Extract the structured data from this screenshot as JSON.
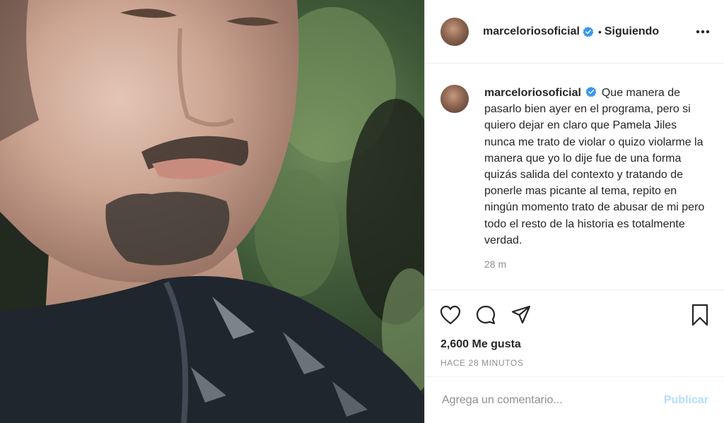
{
  "post": {
    "author": {
      "username": "marceloriosoficial",
      "verified": true,
      "verified_icon": "verified-badge-icon",
      "avatar_icon": "profile-avatar"
    },
    "header": {
      "separator": "•",
      "follow_label": "Siguiendo",
      "more_icon": "more-options-icon"
    },
    "caption": {
      "username": "marceloriosoficial",
      "text": "Que manera de pasarlo bien ayer en el programa, pero si quiero dejar en claro que Pamela Jiles nunca me trato de violar o quizo violarme la manera que yo lo dije fue de una forma quizás salida del contexto y tratando de ponerle mas picante al tema, repito en ningún momento trato de abusar de mi pero todo el resto de la historia es totalmente verdad.",
      "time_ago": "28 m"
    },
    "actions": {
      "like_icon": "heart-icon",
      "comment_icon": "comment-icon",
      "share_icon": "share-icon",
      "save_icon": "bookmark-icon"
    },
    "likes": "2,600 Me gusta",
    "date": "HACE 28 MINUTOS",
    "add_comment": {
      "placeholder": "Agrega un comentario...",
      "publish_label": "Publicar"
    },
    "colors": {
      "verified": "#3897f0",
      "text": "#262626",
      "secondary": "#8e8e8e",
      "publish_disabled": "#b2dffc",
      "border": "#dbdbdb"
    }
  }
}
